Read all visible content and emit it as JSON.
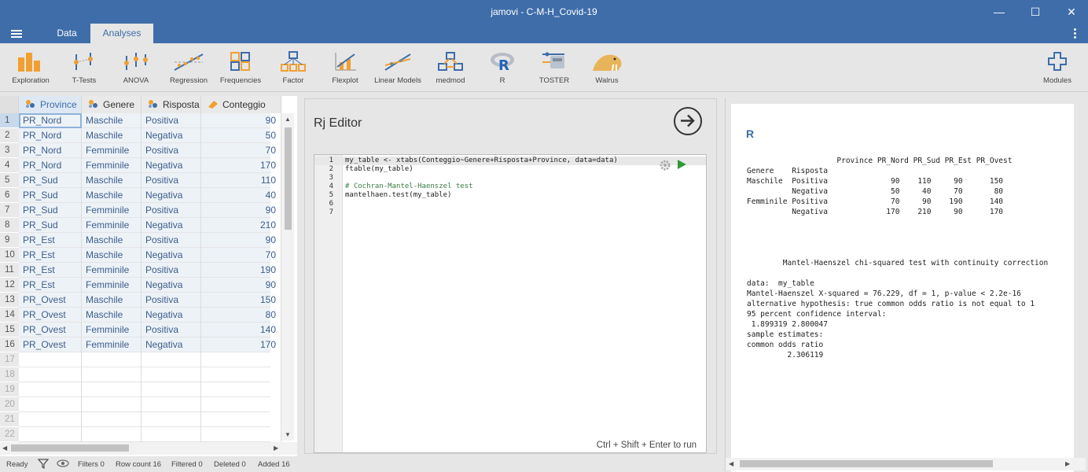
{
  "window": {
    "title": "jamovi - C-M-H_Covid-19",
    "controls": [
      "—",
      "☐",
      "✕"
    ]
  },
  "tabs": [
    {
      "label": "Data",
      "active": false
    },
    {
      "label": "Analyses",
      "active": true
    }
  ],
  "ribbon": [
    {
      "label": "Exploration",
      "icon": "exploration-icon"
    },
    {
      "label": "T-Tests",
      "icon": "t-tests-icon"
    },
    {
      "label": "ANOVA",
      "icon": "anova-icon"
    },
    {
      "label": "Regression",
      "icon": "regression-icon"
    },
    {
      "label": "Frequencies",
      "icon": "frequencies-icon"
    },
    {
      "label": "Factor",
      "icon": "factor-icon"
    },
    {
      "label": "Flexplot",
      "icon": "flexplot-icon"
    },
    {
      "label": "Linear Models",
      "icon": "linear-models-icon"
    },
    {
      "label": "medmod",
      "icon": "medmod-icon"
    },
    {
      "label": "R",
      "icon": "r-icon"
    },
    {
      "label": "TOSTER",
      "icon": "toster-icon"
    },
    {
      "label": "Walrus",
      "icon": "walrus-icon"
    },
    {
      "label": "Modules",
      "icon": "modules-plus-icon"
    }
  ],
  "spreadsheet": {
    "columns": [
      "Province",
      "Genere",
      "Risposta",
      "Conteggio"
    ],
    "rows": [
      [
        "PR_Nord",
        "Maschile",
        "Positiva",
        "90"
      ],
      [
        "PR_Nord",
        "Maschile",
        "Negativa",
        "50"
      ],
      [
        "PR_Nord",
        "Femminile",
        "Positiva",
        "70"
      ],
      [
        "PR_Nord",
        "Femminile",
        "Negativa",
        "170"
      ],
      [
        "PR_Sud",
        "Maschile",
        "Positiva",
        "110"
      ],
      [
        "PR_Sud",
        "Maschile",
        "Negativa",
        "40"
      ],
      [
        "PR_Sud",
        "Femminile",
        "Positiva",
        "90"
      ],
      [
        "PR_Sud",
        "Femminile",
        "Negativa",
        "210"
      ],
      [
        "PR_Est",
        "Maschile",
        "Positiva",
        "90"
      ],
      [
        "PR_Est",
        "Maschile",
        "Negativa",
        "70"
      ],
      [
        "PR_Est",
        "Femminile",
        "Positiva",
        "190"
      ],
      [
        "PR_Est",
        "Femminile",
        "Negativa",
        "90"
      ],
      [
        "PR_Ovest",
        "Maschile",
        "Positiva",
        "150"
      ],
      [
        "PR_Ovest",
        "Maschile",
        "Negativa",
        "80"
      ],
      [
        "PR_Ovest",
        "Femminile",
        "Positiva",
        "140"
      ],
      [
        "PR_Ovest",
        "Femminile",
        "Negativa",
        "170"
      ]
    ],
    "row_numbers": [
      "1",
      "2",
      "3",
      "4",
      "5",
      "6",
      "7",
      "8",
      "9",
      "10",
      "11",
      "12",
      "13",
      "14",
      "15",
      "16",
      "17",
      "18",
      "19",
      "20",
      "21",
      "22"
    ]
  },
  "status": {
    "ready": "Ready",
    "filters": "Filters 0",
    "row_count": "Row count 16",
    "filtered": "Filtered 0",
    "deleted": "Deleted 0",
    "added": "Added 16"
  },
  "editor": {
    "title": "Rj Editor",
    "lines": [
      {
        "n": "1",
        "text": "my_table <- xtabs(Conteggio~Genere+Risposta+Province, data=data)",
        "comment": false
      },
      {
        "n": "2",
        "text": "ftable(my_table)",
        "comment": false
      },
      {
        "n": "3",
        "text": "",
        "comment": false
      },
      {
        "n": "4",
        "text": "# Cochran-Mantel-Haenszel test",
        "comment": true
      },
      {
        "n": "5",
        "text": "mantelhaen.test(my_table)",
        "comment": false
      },
      {
        "n": "6",
        "text": "",
        "comment": false
      },
      {
        "n": "7",
        "text": "",
        "comment": false
      }
    ],
    "run_hint": "Ctrl + Shift + Enter to run"
  },
  "results": {
    "title": "R",
    "output": "                    Province PR_Nord PR_Sud PR_Est PR_Ovest\nGenere    Risposta\nMaschile  Positiva              90    110     90      150\n          Negativa              50     40     70       80\nFemminile Positiva              70     90    190      140\n          Negativa             170    210     90      170\n\n\n\n\n\tMantel-Haenszel chi-squared test with continuity correction\n\ndata:  my_table\nMantel-Haenszel X-squared = 76.229, df = 1, p-value < 2.2e-16\nalternative hypothesis: true common odds ratio is not equal to 1\n95 percent confidence interval:\n 1.899319 2.800047\nsample estimates:\ncommon odds ratio\n         2.306119"
  },
  "colors": {
    "brand": "#3e6da9",
    "run": "#2e9a3a"
  }
}
